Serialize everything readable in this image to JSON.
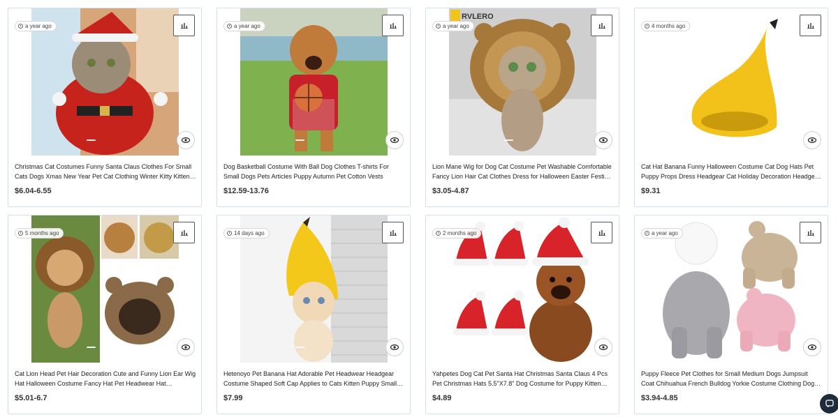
{
  "products": [
    {
      "age": "a year ago",
      "title": "Christmas Cat Costumes Funny Santa Claus Clothes For Small Cats Dogs Xmas New Year Pet Cat Clothing Winter Kitty Kitten Costume",
      "price": "$6.04-6.55",
      "image": "cat in santa costume"
    },
    {
      "age": "a year ago",
      "title": "Dog Basketball Costume With Ball Dog Clothes T-shirts For Small Dogs Pets Articles Puppy Autumn Pet Cotton Vests",
      "price": "$12.59-13.76",
      "image": "dog in basketball jersey"
    },
    {
      "age": "a year ago",
      "title": "Lion Mane Wig for Dog Cat Costume Pet Washable Comfortable Fancy Lion Hair Cat Clothes Dress for Halloween Easter Festival Party",
      "price": "$3.05-4.87",
      "image": "cat with lion mane",
      "watermark": "RVLERO"
    },
    {
      "age": "4 months ago",
      "title": "Cat Hat Banana Funny Halloween Costume Cat Dog Hats Pet Puppy Props Dress Headgear Cat Holiday Decoration Headgear Pet",
      "price": "$9.31",
      "image": "banana hat"
    },
    {
      "age": "5 months ago",
      "title": "Cat Lion Head Pet Hair Decoration Cute and Funny Lion Ear Wig Hat Halloween Costume Fancy Hat Pet Headwear Hat Decorative Accessories",
      "price": "$5.01-6.7",
      "image": "cat lion head wig collage"
    },
    {
      "age": "14 days ago",
      "title": "Hetenoyo Pet Banana Hat Adorable Pet Headwear Headgear Costume Shaped Soft Cap Applies to Cats Kitten Puppy Small Dogs",
      "price": "$7.99",
      "image": "kitten in banana hat"
    },
    {
      "age": "2 months ago",
      "title": "Yahpetes Dog Cat Pet Santa Hat Christmas Santa Claus 4 Pcs Pet Christmas Hats 5.5\"X7.8\" Dog Costume for Puppy Kitten Small Cats",
      "price": "$4.89",
      "image": "puppy in santa hat with four hats"
    },
    {
      "age": "a year ago",
      "title": "Puppy Fleece Pet Clothes for Small Medium Dogs Jumpsuit Coat Chihuahua French Bulldog Yorkie Costume Clothing Dog Supplies",
      "price": "$3.94-4.85",
      "image": "fleece dog jumpsuits"
    }
  ],
  "icons": {
    "age": "clock-icon",
    "stats": "bar-chart-icon",
    "preview": "eye-icon",
    "chat": "chat-icon"
  },
  "colors": {
    "card_border": "#cfe0ef",
    "chat_bg": "#1d2b3a"
  }
}
